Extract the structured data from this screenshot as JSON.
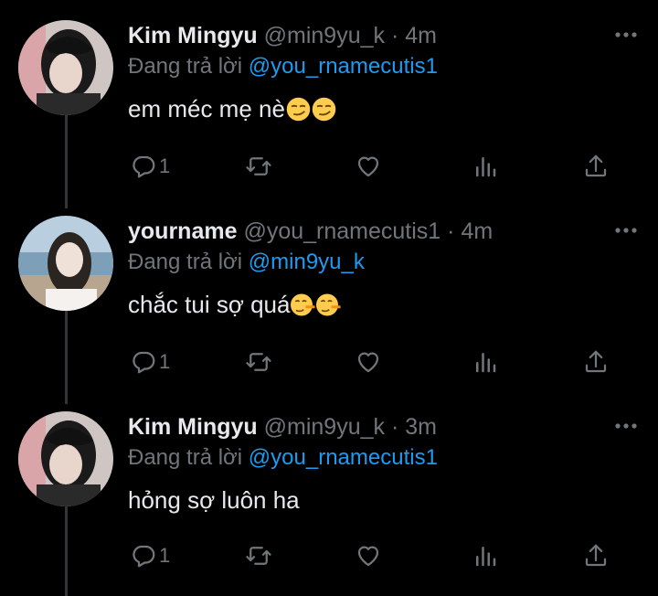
{
  "tweets": [
    {
      "name": "Kim Mingyu",
      "handle": "@min9yu_k",
      "separator": "·",
      "time": "4m",
      "reply_prefix": "Đang trả lời",
      "reply_to": "@you_rnamecutis1",
      "text": "em méc mẹ nè",
      "emoji": [
        "smirking-face",
        "smirking-face"
      ],
      "reply_count": "1"
    },
    {
      "name": "yourname",
      "handle": "@you_rnamecutis1",
      "separator": "·",
      "time": "4m",
      "reply_prefix": "Đang trả lời",
      "reply_to": "@min9yu_k",
      "text": "chắc tui sợ quá",
      "emoji": [
        "lying-face",
        "lying-face"
      ],
      "reply_count": "1"
    },
    {
      "name": "Kim Mingyu",
      "handle": "@min9yu_k",
      "separator": "·",
      "time": "3m",
      "reply_prefix": "Đang trả lời",
      "reply_to": "@you_rnamecutis1",
      "text": "hỏng sợ luôn ha",
      "emoji": [],
      "reply_count": "1"
    }
  ],
  "icons": {
    "more": "more-horizontal-icon",
    "reply": "reply-bubble-icon",
    "retweet": "retweet-icon",
    "like": "heart-icon",
    "views": "analytics-bars-icon",
    "share": "share-upload-icon"
  },
  "colors": {
    "background": "#000000",
    "text_primary": "#e7e9ea",
    "text_secondary": "#71767b",
    "accent": "#1d9bf0",
    "thread_line": "#333639"
  }
}
